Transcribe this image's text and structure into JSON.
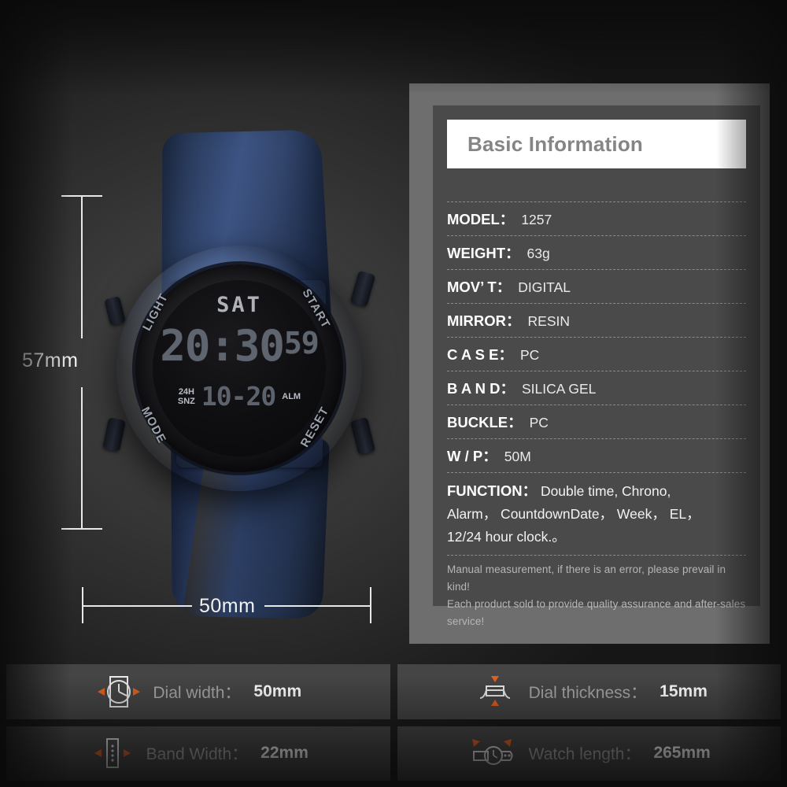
{
  "product": {
    "watch_display": {
      "day": "SAT",
      "time_main": "20:30",
      "time_seconds": "59",
      "flag_top": "24H",
      "flag_bottom": "SNZ",
      "sub_value": "10-20",
      "alarm_flag": "ALM",
      "bezel": {
        "top_left": "LIGHT",
        "top_right": "START",
        "bottom_left": "MODE",
        "bottom_right": "RESET"
      }
    },
    "dimensions": {
      "height_label": "57mm",
      "width_label": "50mm"
    }
  },
  "panel": {
    "title": "Basic Information",
    "specs": [
      {
        "key": "MODEL：",
        "value": "1257"
      },
      {
        "key": "WEIGHT：",
        "value": "63g"
      },
      {
        "key": "MOV’ T：",
        "value": "DIGITAL"
      },
      {
        "key": "MIRROR：",
        "value": "RESIN"
      },
      {
        "key": "C A S E：",
        "value": "PC"
      },
      {
        "key": "B A N D：",
        "value": "SILICA GEL"
      },
      {
        "key": "BUCKLE：",
        "value": "PC"
      },
      {
        "key": "W / P：",
        "value": "50M"
      }
    ],
    "function": {
      "key": "FUNCTION：",
      "line1": "Double time, Chrono,",
      "line2": "Alarm， CountdownDate， Week， EL，",
      "line3": "12/24 hour clock.。"
    },
    "notes": [
      "Manual measurement, if there is an error, please prevail in kind!",
      "Each product sold to provide quality assurance and after-sales service!"
    ]
  },
  "measure_boxes": [
    {
      "icon": "watch-dial-width-icon",
      "label": "Dial width：",
      "value": "50mm"
    },
    {
      "icon": "watch-dial-thickness-icon",
      "label": "Dial thickness：",
      "value": "15mm"
    },
    {
      "icon": "watch-band-width-icon",
      "label": "Band Width：",
      "value": "22mm"
    },
    {
      "icon": "watch-length-icon",
      "label": "Watch length：",
      "value": "265mm"
    }
  ],
  "colors": {
    "background": "#1e1e1e",
    "panel_frame": "#6e6e6e",
    "panel_inner": "#4a4a4a",
    "header_bg": "#ffffff",
    "header_text": "#858585",
    "box_bg": "#454545",
    "accent_orange": "#e2611f",
    "strap_navy": "#2d4063",
    "dimension_line": "#e8e8e8"
  }
}
